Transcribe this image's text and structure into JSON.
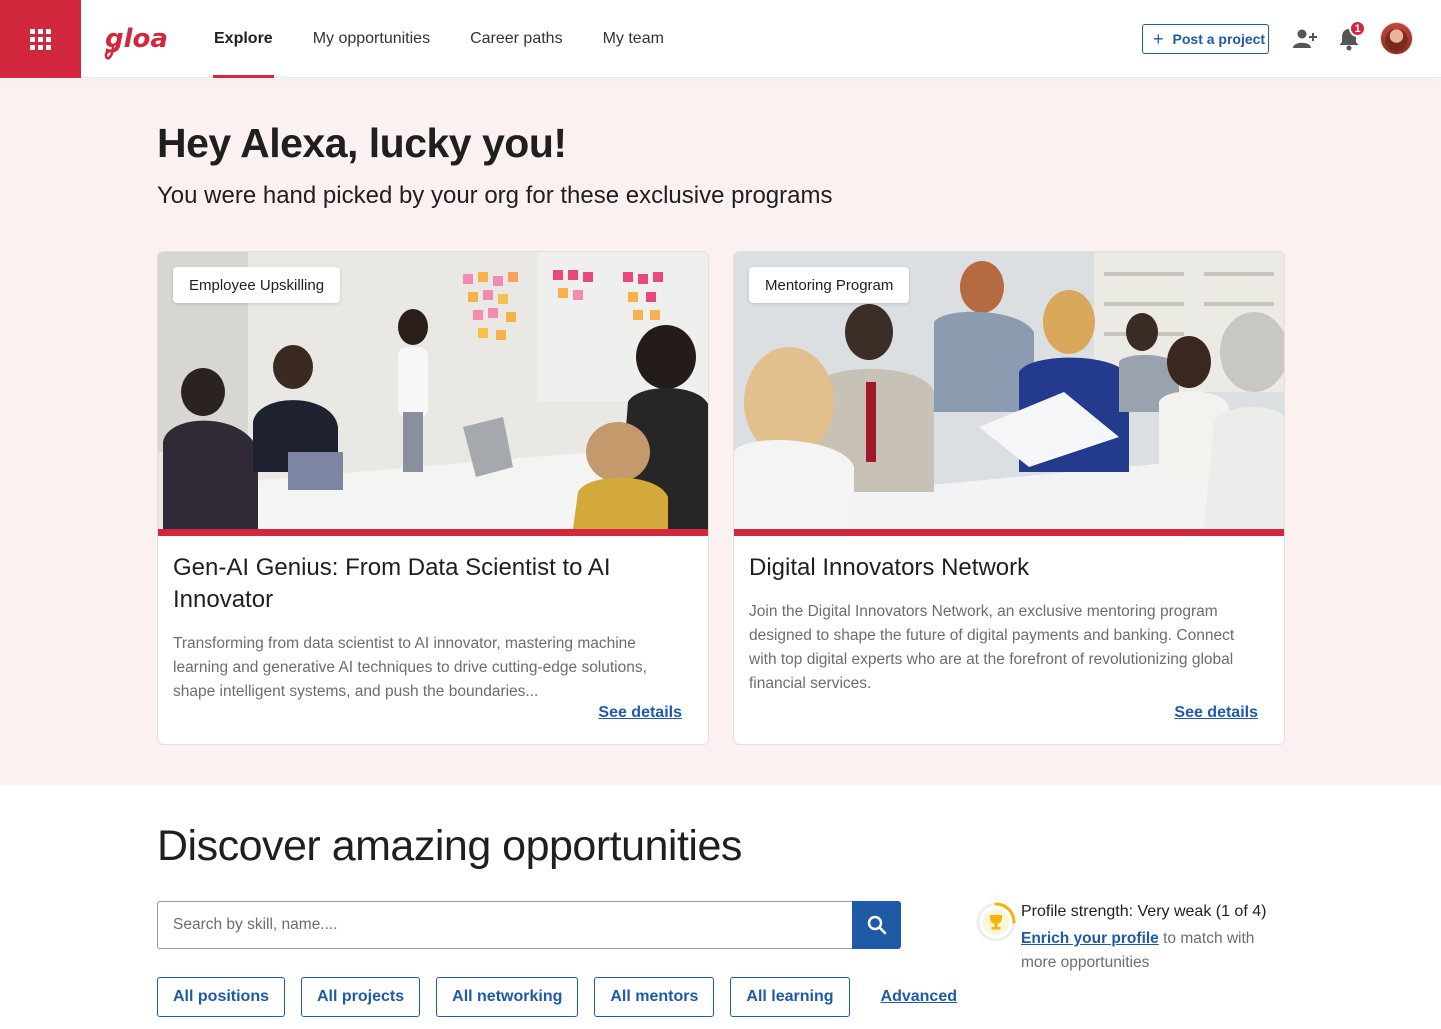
{
  "nav": {
    "apps_icon": "app-grid-icon",
    "logo_text": "gloat",
    "items": [
      {
        "label": "Explore",
        "active": true
      },
      {
        "label": "My opportunities",
        "active": false
      },
      {
        "label": "Career paths",
        "active": false
      },
      {
        "label": "My team",
        "active": false
      }
    ],
    "post_button": "Post a project",
    "notification_count": "1",
    "accent_color": "#d3273e",
    "link_color": "#1f5aa6"
  },
  "hero": {
    "title": "Hey Alexa, lucky you!",
    "subtitle": "You were hand picked by your org for these exclusive programs",
    "background": "#fcf1f1",
    "cards": [
      {
        "tag": "Employee Upskilling",
        "title": "Gen-AI Genius: From Data Scientist to AI Innovator",
        "description": "Transforming from data scientist to AI innovator, mastering machine learning and generative AI techniques to drive cutting-edge solutions, shape intelligent systems, and push the boundaries...",
        "link": "See details"
      },
      {
        "tag": "Mentoring Program",
        "title": "Digital Innovators Network",
        "description": "Join the Digital Innovators Network, an exclusive mentoring program designed to shape the future of digital payments and banking. Connect with top digital experts who are at the forefront of revolutionizing global financial services.",
        "link": "See details"
      }
    ]
  },
  "discover": {
    "title": "Discover amazing opportunities",
    "search_placeholder": "Search by skill, name....",
    "filters": [
      "All positions",
      "All projects",
      "All networking",
      "All mentors",
      "All learning"
    ],
    "advanced": "Advanced",
    "profile_strength": {
      "heading": "Profile strength: Very weak (1 of 4)",
      "link": "Enrich your profile",
      "rest": " to match with more opportunities",
      "level": 0.25
    }
  }
}
